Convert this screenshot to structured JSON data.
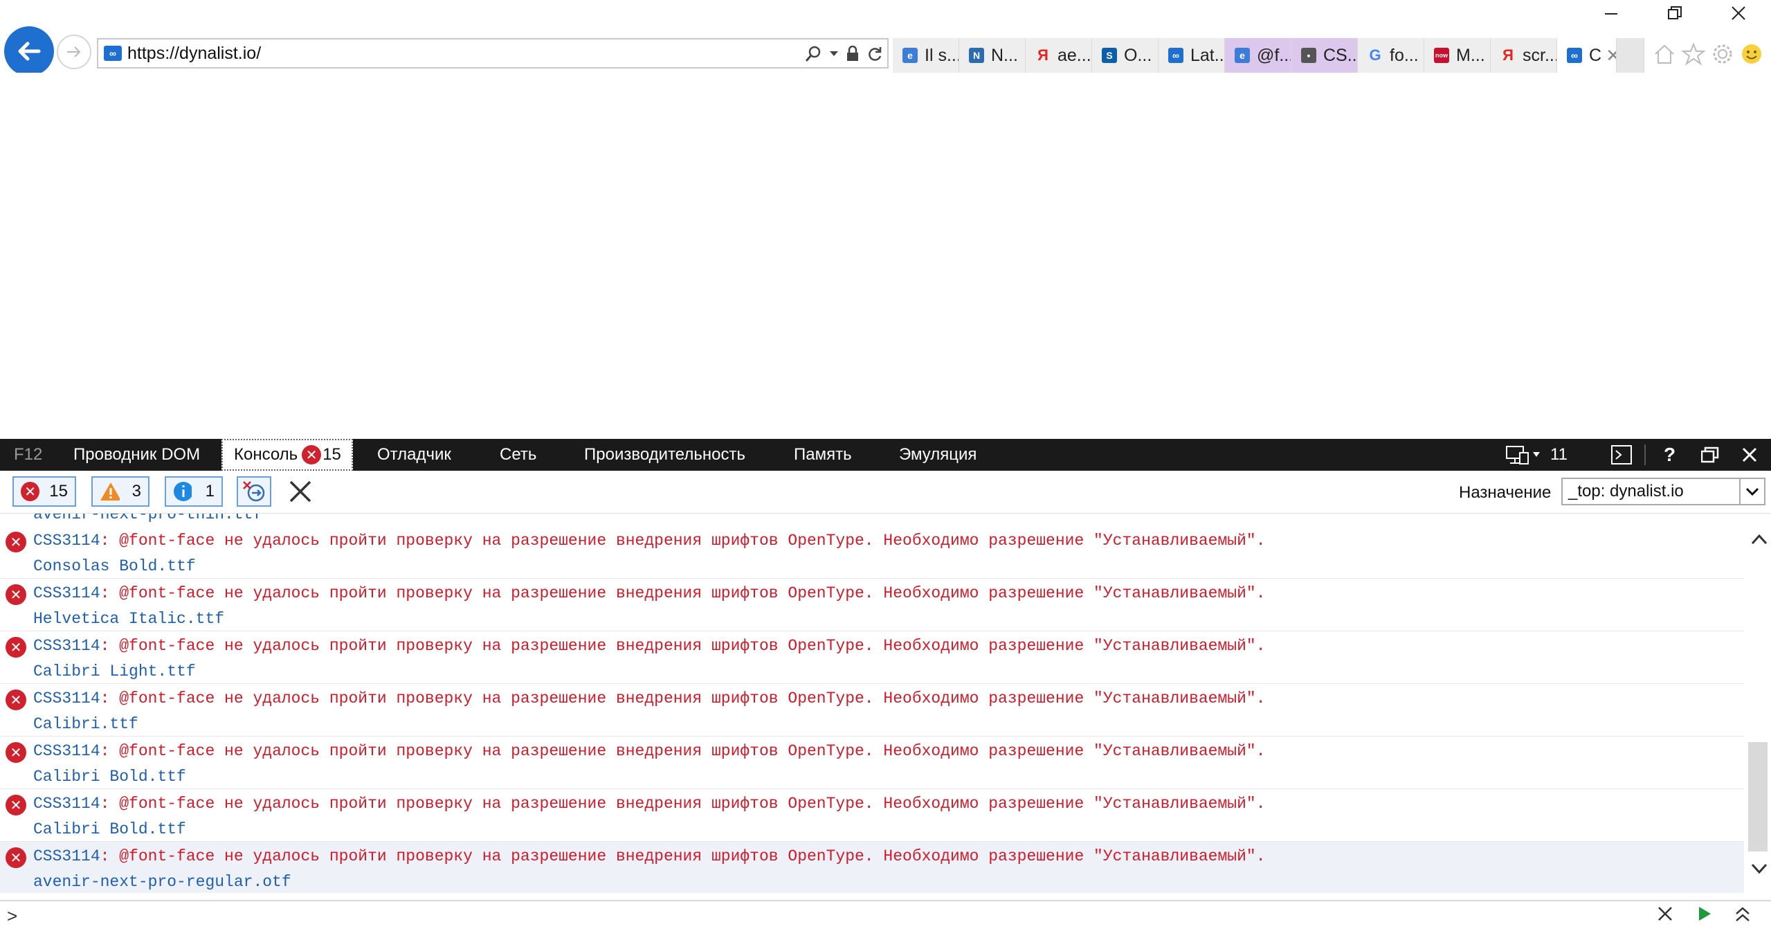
{
  "browser": {
    "url": "https://dynalist.io/",
    "tabs": [
      {
        "label": "Il s...",
        "icon": "ie-icon",
        "color": "#3b7dd8"
      },
      {
        "label": "N...",
        "icon": "page-icon",
        "color": "#2b6cb0"
      },
      {
        "label": "ae...",
        "icon": "yandex-icon",
        "color": "#e52620"
      },
      {
        "label": "O...",
        "icon": "sharepoint-icon",
        "color": "#0b5ea8"
      },
      {
        "label": "Lat...",
        "icon": "dynalist-icon",
        "color": "#1f6fd1"
      },
      {
        "label": "@f...",
        "icon": "ie-icon",
        "color": "#3b7dd8"
      },
      {
        "label": "CS...",
        "icon": "puzzle-icon",
        "color": "#555555"
      },
      {
        "label": "fo...",
        "icon": "google-icon",
        "color": "#4285f4"
      },
      {
        "label": "M...",
        "icon": "news-icon",
        "color": "#c8102e"
      },
      {
        "label": "scr...",
        "icon": "yandex-icon",
        "color": "#e52620"
      },
      {
        "label": "C",
        "icon": "dynalist-icon",
        "color": "#1f6fd1"
      }
    ]
  },
  "devtools": {
    "tabs": {
      "f12": "F12",
      "dom": "Проводник DOM",
      "console": "Консоль",
      "console_errors": "15",
      "debugger": "Отладчик",
      "network": "Сеть",
      "performance": "Производительность",
      "memory": "Память",
      "emulation": "Эмуляция"
    },
    "doc_mode": "11",
    "filters": {
      "errors": "15",
      "warnings": "3",
      "info": "1"
    },
    "target_label": "Назначение",
    "target_value": "_top: dynalist.io",
    "cut_off_line": "avenir-next-pro-thin.ttf",
    "messages": [
      {
        "code": "CSS3114",
        "text": ": @font-face не удалось пройти проверку на разрешение внедрения шрифтов OpenType. Необходимо разрешение \"Устанавливаемый\".",
        "file": "Consolas Bold.ttf"
      },
      {
        "code": "CSS3114",
        "text": ": @font-face не удалось пройти проверку на разрешение внедрения шрифтов OpenType. Необходимо разрешение \"Устанавливаемый\".",
        "file": "Helvetica Italic.ttf"
      },
      {
        "code": "CSS3114",
        "text": ": @font-face не удалось пройти проверку на разрешение внедрения шрифтов OpenType. Необходимо разрешение \"Устанавливаемый\".",
        "file": "Calibri Light.ttf"
      },
      {
        "code": "CSS3114",
        "text": ": @font-face не удалось пройти проверку на разрешение внедрения шрифтов OpenType. Необходимо разрешение \"Устанавливаемый\".",
        "file": "Calibri.ttf"
      },
      {
        "code": "CSS3114",
        "text": ": @font-face не удалось пройти проверку на разрешение внедрения шрифтов OpenType. Необходимо разрешение \"Устанавливаемый\".",
        "file": "Calibri Bold.ttf"
      },
      {
        "code": "CSS3114",
        "text": ": @font-face не удалось пройти проверку на разрешение внедрения шрифтов OpenType. Необходимо разрешение \"Устанавливаемый\".",
        "file": "Calibri Bold.ttf"
      },
      {
        "code": "CSS3114",
        "text": ": @font-face не удалось пройти проверку на разрешение внедрения шрифтов OpenType. Необходимо разрешение \"Устанавливаемый\".",
        "file": "avenir-next-pro-regular.otf"
      }
    ],
    "prompt": ">"
  }
}
